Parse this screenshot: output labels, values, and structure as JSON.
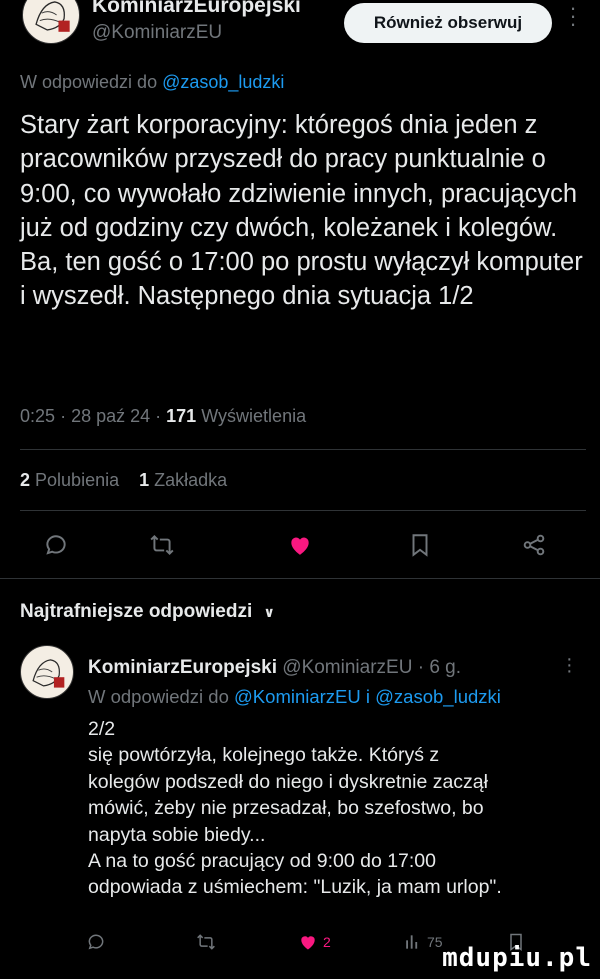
{
  "post": {
    "author_name": "KominiarzEuropejski",
    "author_handle": "@KominiarzEU",
    "follow_label": "Również obserwuj",
    "reply_prefix": "W odpowiedzi do",
    "reply_mention": "@zasob_ludzki",
    "text": "Stary żart korporacyjny: któregoś dnia jeden z pracowników przyszedł do pracy punktualnie o 9:00, co wywołało zdziwienie innych, pracujących już od godziny czy dwóch, koleżanek i kolegów. Ba, ten gość o 17:00 po prostu wyłączył komputer i wyszedł. Następnego dnia sytuacja 1/2",
    "time": "0:25",
    "date": "28 paź 24",
    "views_count": "171",
    "views_label": "Wyświetlenia",
    "likes_count": "2",
    "likes_label": "Polubienia",
    "bookmarks_count": "1",
    "bookmarks_label": "Zakładka"
  },
  "icons": {
    "reply": "comment-icon",
    "repost": "repost-icon",
    "like": "heart-icon",
    "bookmark": "bookmark-icon",
    "share": "share-icon",
    "views": "views-icon"
  },
  "colors": {
    "background": "#000000",
    "text": "#e7e9ea",
    "secondary": "#71767b",
    "link": "#1d9bf0",
    "like": "#f91880"
  },
  "best_replies_label": "Najtrafniejsze odpowiedzi",
  "reply": {
    "author_name": "KominiarzEuropejski",
    "author_handle": "@KominiarzEU",
    "age": "6 g.",
    "reply_prefix": "W odpowiedzi do",
    "reply_mentions": "@KominiarzEU i @zasob_ludzki",
    "text_lines": [
      "2/2",
      "się powtórzyła, kolejnego także. Któryś z",
      "kolegów podszedł do niego i dyskretnie zaczął",
      "mówić, żeby nie przesadzał, bo szefostwo, bo",
      "napyta sobie biedy...",
      "A na to gość pracujący od 9:00 do 17:00",
      "odpowiada z uśmiechem: \"Luzik, ja mam urlop\"."
    ],
    "likes_count": "2",
    "views_count": "75"
  },
  "watermark": "mdupiu.pl"
}
